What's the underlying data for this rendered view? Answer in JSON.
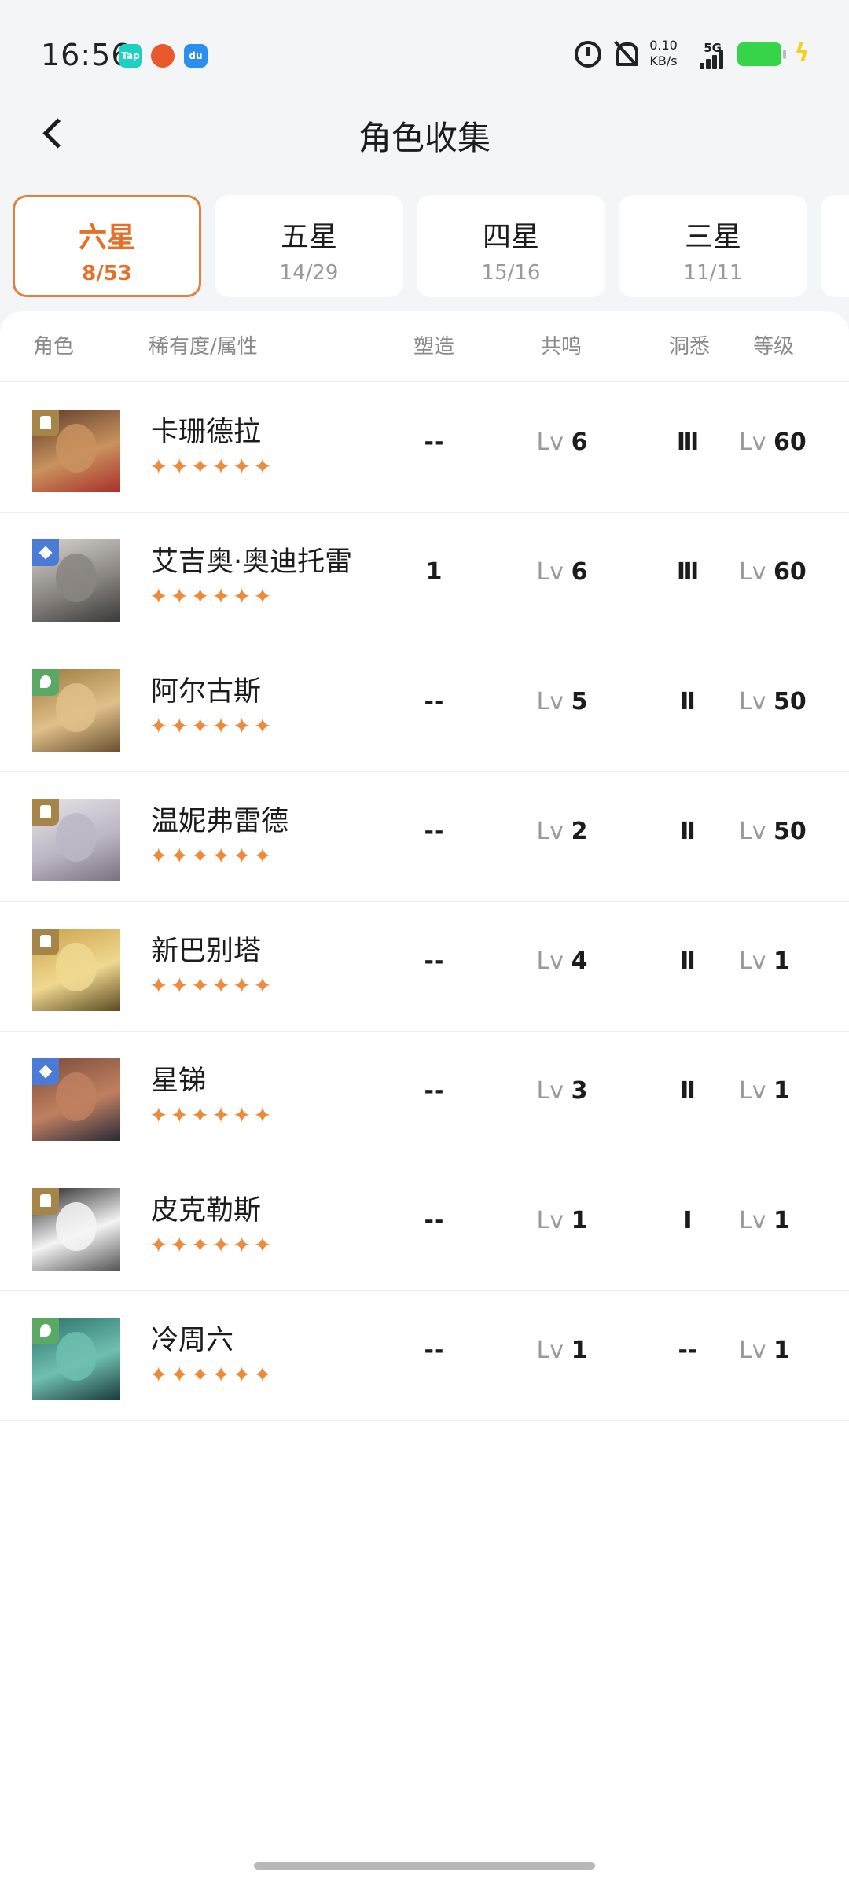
{
  "status_bar": {
    "time": "16:56",
    "app_icons": [
      "Tap",
      "",
      "du"
    ],
    "net_speed_value": "0.10",
    "net_speed_unit": "KB/s",
    "network": "5G",
    "icons": [
      "alarm-icon",
      "mute-icon",
      "signal-icon",
      "battery-icon",
      "charge-icon"
    ]
  },
  "header": {
    "title": "角色收集"
  },
  "tabs": [
    {
      "label": "六星",
      "count": "8/53",
      "active": true
    },
    {
      "label": "五星",
      "count": "14/29",
      "active": false
    },
    {
      "label": "四星",
      "count": "15/16",
      "active": false
    },
    {
      "label": "三星",
      "count": "11/11",
      "active": false
    }
  ],
  "columns": [
    "角色",
    "稀有度/属性",
    "塑造",
    "共鸣",
    "洞悉",
    "等级"
  ],
  "lv_label": "Lv",
  "characters": [
    {
      "name": "卡珊德拉",
      "stars": "✦✦✦✦✦✦",
      "attribute_icon": "earth-icon",
      "shaping": "--",
      "resonance": "6",
      "insight": "Ⅲ",
      "level": "60"
    },
    {
      "name": "艾吉奥·奥迪托雷",
      "stars": "✦✦✦✦✦✦",
      "attribute_icon": "star-icon",
      "shaping": "1",
      "resonance": "6",
      "insight": "Ⅲ",
      "level": "60"
    },
    {
      "name": "阿尔古斯",
      "stars": "✦✦✦✦✦✦",
      "attribute_icon": "plant-icon",
      "shaping": "--",
      "resonance": "5",
      "insight": "Ⅱ",
      "level": "50"
    },
    {
      "name": "温妮弗雷德",
      "stars": "✦✦✦✦✦✦",
      "attribute_icon": "earth-icon",
      "shaping": "--",
      "resonance": "2",
      "insight": "Ⅱ",
      "level": "50"
    },
    {
      "name": "新巴别塔",
      "stars": "✦✦✦✦✦✦",
      "attribute_icon": "earth-icon",
      "shaping": "--",
      "resonance": "4",
      "insight": "Ⅱ",
      "level": "1"
    },
    {
      "name": "星锑",
      "stars": "✦✦✦✦✦✦",
      "attribute_icon": "star-icon",
      "shaping": "--",
      "resonance": "3",
      "insight": "Ⅱ",
      "level": "1"
    },
    {
      "name": "皮克勒斯",
      "stars": "✦✦✦✦✦✦",
      "attribute_icon": "earth-icon",
      "shaping": "--",
      "resonance": "1",
      "insight": "Ⅰ",
      "level": "1"
    },
    {
      "name": "冷周六",
      "stars": "✦✦✦✦✦✦",
      "attribute_icon": "plant-icon",
      "shaping": "--",
      "resonance": "1",
      "insight": "--",
      "level": "1"
    }
  ]
}
